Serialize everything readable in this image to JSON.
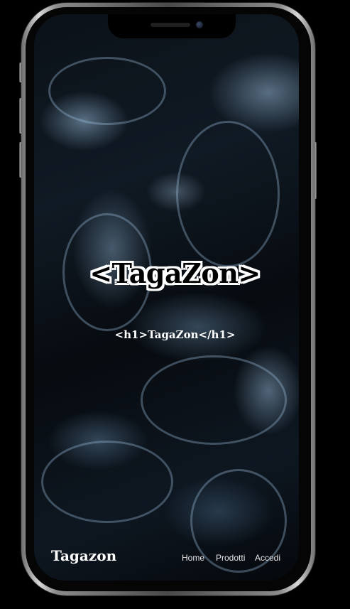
{
  "hero": {
    "title": "<TagaZon>",
    "subtitle": "<h1>TagaZon</h1>"
  },
  "navbar": {
    "brand": "Tagazon",
    "links": [
      "Home",
      "Prodotti",
      "Accedi"
    ]
  }
}
